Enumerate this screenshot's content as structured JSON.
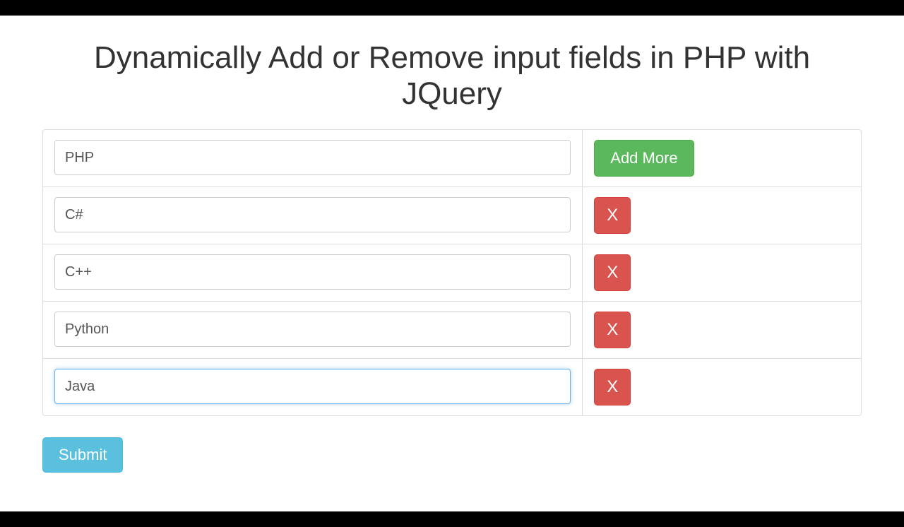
{
  "title": "Dynamically Add or Remove input fields in PHP with JQuery",
  "addMoreLabel": "Add More",
  "removeLabel": "X",
  "submitLabel": "Submit",
  "rows": [
    {
      "value": "PHP",
      "action": "add",
      "focused": false
    },
    {
      "value": "C#",
      "action": "remove",
      "focused": false
    },
    {
      "value": "C++",
      "action": "remove",
      "focused": false
    },
    {
      "value": "Python",
      "action": "remove",
      "focused": false
    },
    {
      "value": "Java",
      "action": "remove",
      "focused": true
    }
  ]
}
